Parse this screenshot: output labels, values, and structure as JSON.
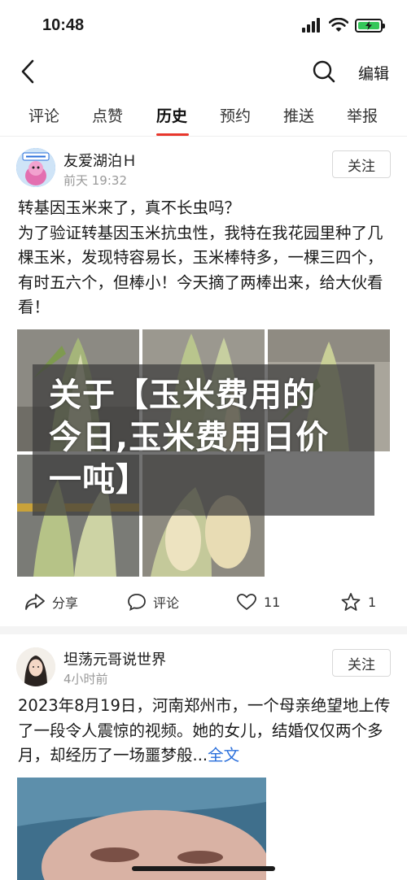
{
  "status": {
    "time": "10:48"
  },
  "nav": {
    "edit_label": "编辑"
  },
  "tabs": [
    {
      "label": "评论"
    },
    {
      "label": "点赞"
    },
    {
      "label": "历史"
    },
    {
      "label": "预约"
    },
    {
      "label": "推送"
    },
    {
      "label": "举报"
    }
  ],
  "active_tab": "历史",
  "posts": [
    {
      "author": "友爱湖泊Ｈ",
      "time": "前天 19:32",
      "avatar_badge": "天气很热",
      "follow_label": "关注",
      "lines": [
        "转基因玉米来了，真不长虫吗？",
        "为了验证转基因玉米抗虫性，我特在我花园里种了几棵玉米，发现特容易长，玉米棒特多，一棵三四个，有时五六个，但棒小！今天摘了两棒出来，给大伙看看！"
      ],
      "share_label": "分享",
      "comment_label": "评论",
      "like_count": "11",
      "fav_count": "1"
    },
    {
      "author": "坦荡元哥说世界",
      "time": "4小时前",
      "follow_label": "关注",
      "text": "2023年8月19日，河南郑州市，一个母亲绝望地上传了一段令人震惊的视频。她的女儿，结婚仅仅两个多月，却经历了一场噩梦般...",
      "more_label": "全文"
    }
  ],
  "overlay": {
    "title": "关于【玉米费用的今日,玉米费用日价一吨】"
  },
  "colors": {
    "accent": "#e8372c",
    "link": "#2a6fdb",
    "battery": "#34c759"
  }
}
